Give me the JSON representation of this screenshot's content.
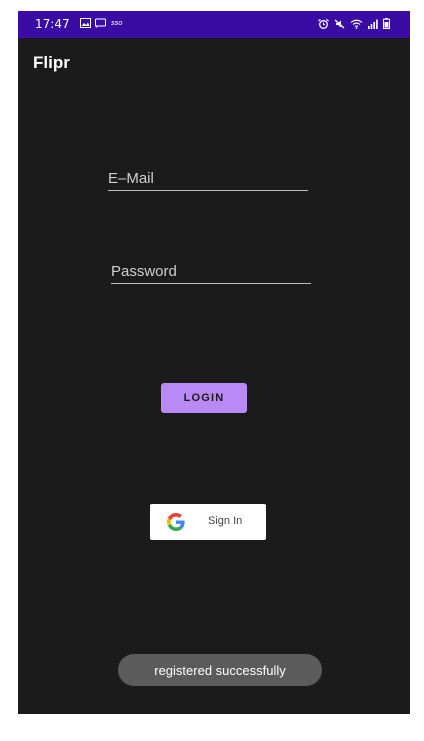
{
  "status_bar": {
    "time": "17:47",
    "extra_label": "sso",
    "icons_left": [
      "image-icon",
      "screen-cast-icon"
    ],
    "icons_right": [
      "alarm-icon",
      "mute-icon",
      "wifi-icon",
      "signal-icon",
      "battery-icon"
    ],
    "color": "#3a0ca3"
  },
  "app": {
    "title": "Flipr",
    "background": "#1b1b1b"
  },
  "form": {
    "email_placeholder": "E–Mail",
    "email_value": "",
    "password_placeholder": "Password",
    "password_value": "",
    "login_label": "LOGIN",
    "login_color": "#b98af5"
  },
  "google": {
    "label": "Sign In",
    "icon": "google-icon"
  },
  "toast": {
    "message": "registered successfully"
  }
}
